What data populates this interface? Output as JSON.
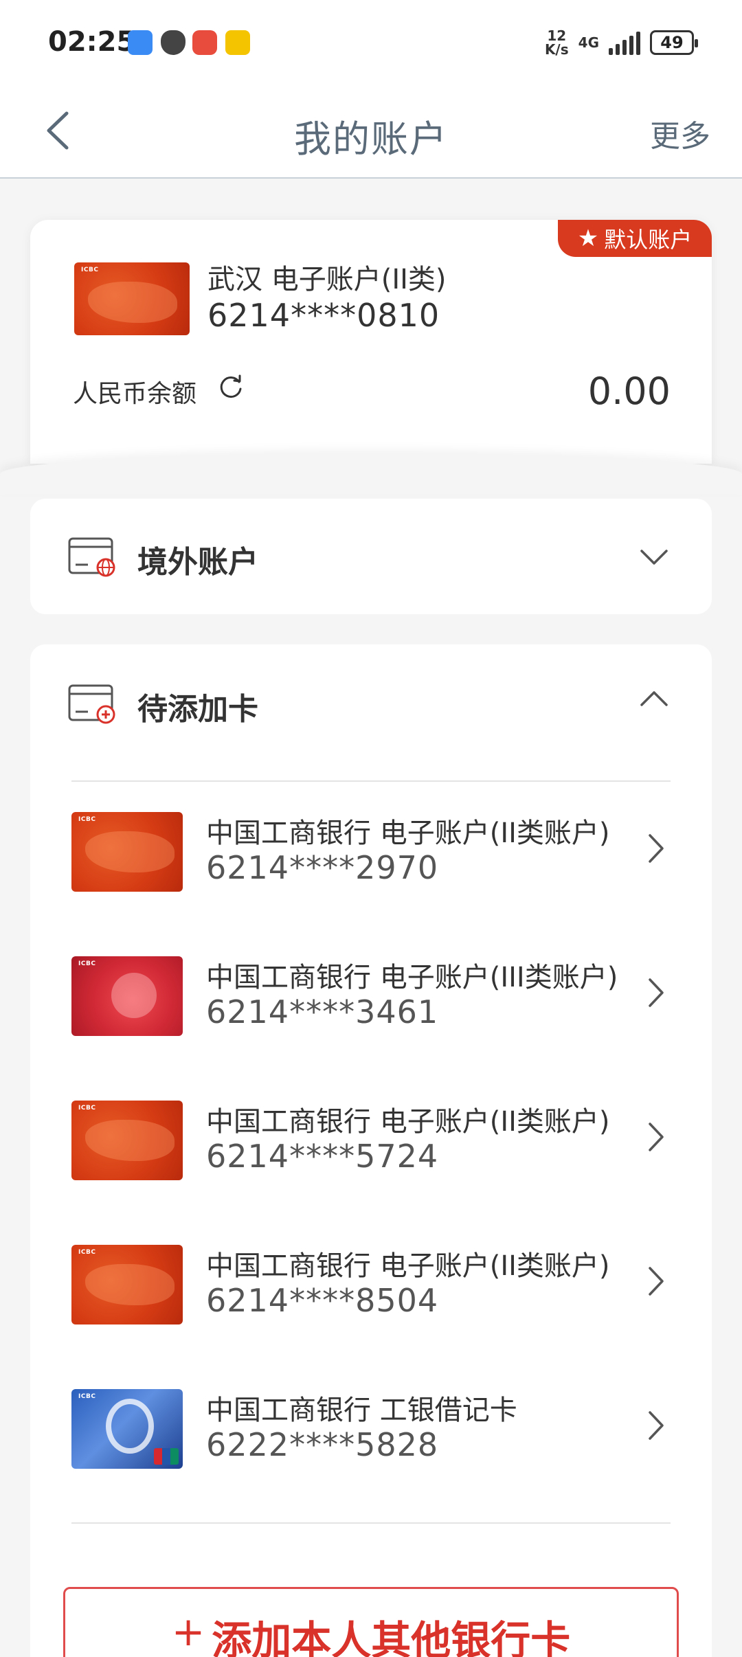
{
  "status_bar": {
    "time": "02:25",
    "net_speed_value": "12",
    "net_speed_unit": "K/s",
    "network": "4G",
    "battery": "49"
  },
  "header": {
    "title": "我的账户",
    "more_label": "更多"
  },
  "default_account": {
    "tag": "默认账户",
    "name": "武汉 电子账户(II类)",
    "number": "6214****0810",
    "balance_label": "人民币余额",
    "balance_value": "0.00"
  },
  "overseas_section": {
    "title": "境外账户"
  },
  "pending_section": {
    "title": "待添加卡",
    "cards": [
      {
        "name": "中国工商银行 电子账户(II类账户)",
        "number": "6214****2970",
        "style": "orange"
      },
      {
        "name": "中国工商银行 电子账户(III类账户)",
        "number": "6214****3461",
        "style": "red"
      },
      {
        "name": "中国工商银行 电子账户(II类账户)",
        "number": "6214****5724",
        "style": "orange"
      },
      {
        "name": "中国工商银行 电子账户(II类账户)",
        "number": "6214****8504",
        "style": "orange"
      },
      {
        "name": "中国工商银行 工银借记卡",
        "number": "6222****5828",
        "style": "blue"
      }
    ]
  },
  "add_button": {
    "label": "添加本人其他银行卡"
  },
  "colors": {
    "accent_red": "#d8322a",
    "header_text": "#5a6a78",
    "background": "#f5f5f5"
  },
  "icons": [
    "back-arrow-icon",
    "refresh-icon",
    "star-icon",
    "overseas-card-icon",
    "add-card-icon",
    "chevron-down-icon",
    "chevron-up-icon",
    "chevron-right-icon"
  ]
}
